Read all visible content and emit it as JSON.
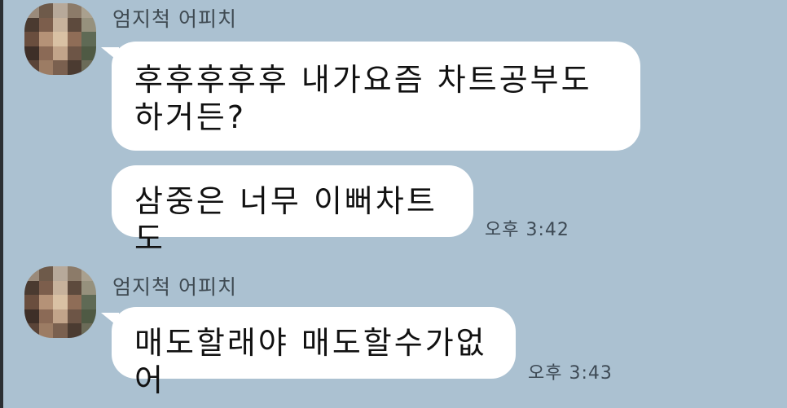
{
  "chat": {
    "groups": [
      {
        "sender": "엄지척 어피치",
        "messages": [
          {
            "text": "후후후후후 내가요즘 차트공부도 하거든?",
            "time": ""
          },
          {
            "text": "삼중은 너무 이뻐차트도",
            "time": "오후 3:42"
          }
        ]
      },
      {
        "sender": "엄지척 어피치",
        "messages": [
          {
            "text": "매도할래야 매도할수가없어",
            "time": "오후 3:43"
          }
        ]
      }
    ]
  },
  "colors": {
    "background": "#abc1d1",
    "bubble": "#ffffff",
    "sender_text": "#3f4a52",
    "time_text": "#3e4a55"
  },
  "icons": {
    "avatar": "blurred-profile-image"
  }
}
